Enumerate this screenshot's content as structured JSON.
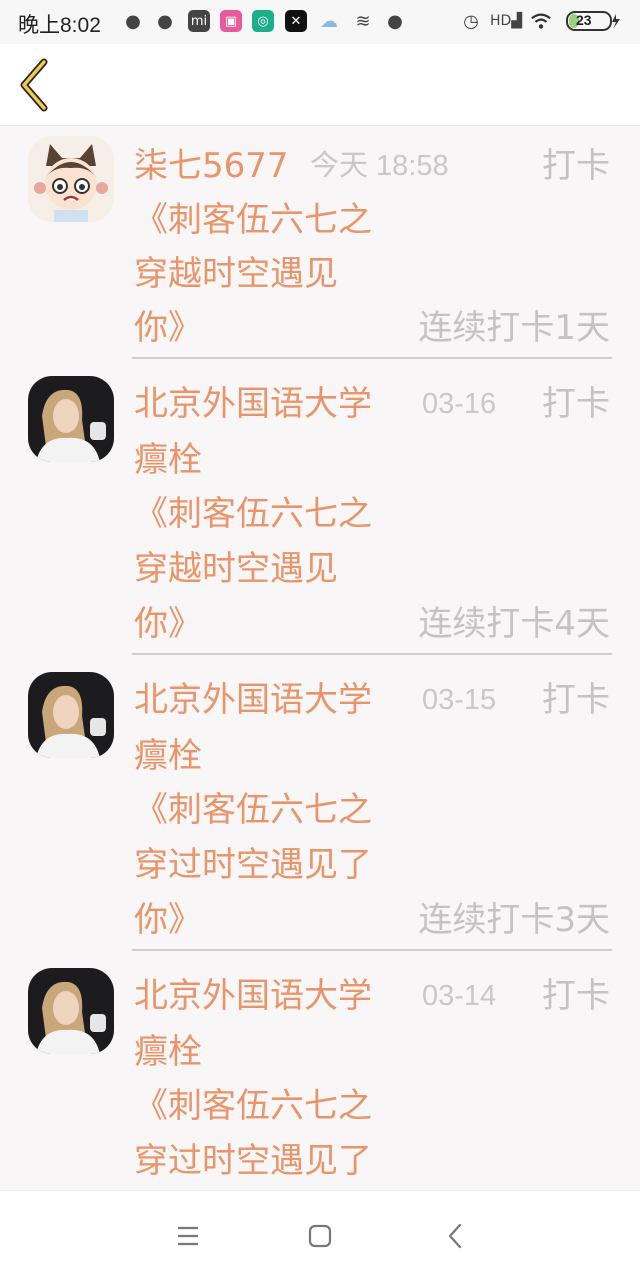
{
  "status_bar": {
    "time": "晚上8:02",
    "battery": "23",
    "icons": [
      "wechat-icon",
      "wechat-icon",
      "mi-store-icon",
      "game-icon",
      "podcast-icon",
      "capcut-icon",
      "cloud-icon",
      "wind-icon",
      "drop-icon",
      "alarm-icon",
      "hd-signal-icon",
      "wifi-icon",
      "battery-icon"
    ]
  },
  "header": {
    "back_icon": "chevron-left-icon",
    "accent": "#f2c94c"
  },
  "colors": {
    "name": "#e8956a",
    "muted": "#c3c3c3",
    "divider": "#cfcfcf"
  },
  "records": [
    {
      "name_lines": [
        "柒七5677"
      ],
      "time": "今天 18:58",
      "action": "打卡",
      "title_lines": [
        "《刺客伍六七之",
        "穿越时空遇见",
        "你》"
      ],
      "streak": "连续打卡1天",
      "avatar": "cartoon-avatar"
    },
    {
      "name_lines": [
        "北京外国语大学",
        "癝栓"
      ],
      "time": "03-16",
      "action": "打卡",
      "title_lines": [
        "《刺客伍六七之",
        "穿越时空遇见",
        "你》"
      ],
      "streak": "连续打卡4天",
      "avatar": "photo-avatar"
    },
    {
      "name_lines": [
        "北京外国语大学",
        "癝栓"
      ],
      "time": "03-15",
      "action": "打卡",
      "title_lines": [
        "《刺客伍六七之",
        "穿过时空遇见了",
        "你》"
      ],
      "streak": "连续打卡3天",
      "avatar": "photo-avatar"
    },
    {
      "name_lines": [
        "北京外国语大学",
        "癝栓"
      ],
      "time": "03-14",
      "action": "打卡",
      "title_lines": [
        "《刺客伍六七之",
        "穿过时空遇见了"
      ],
      "streak": "",
      "avatar": "photo-avatar"
    }
  ],
  "nav": {
    "menu_icon": "menu-icon",
    "home_icon": "home-icon",
    "back_icon": "back-icon"
  }
}
